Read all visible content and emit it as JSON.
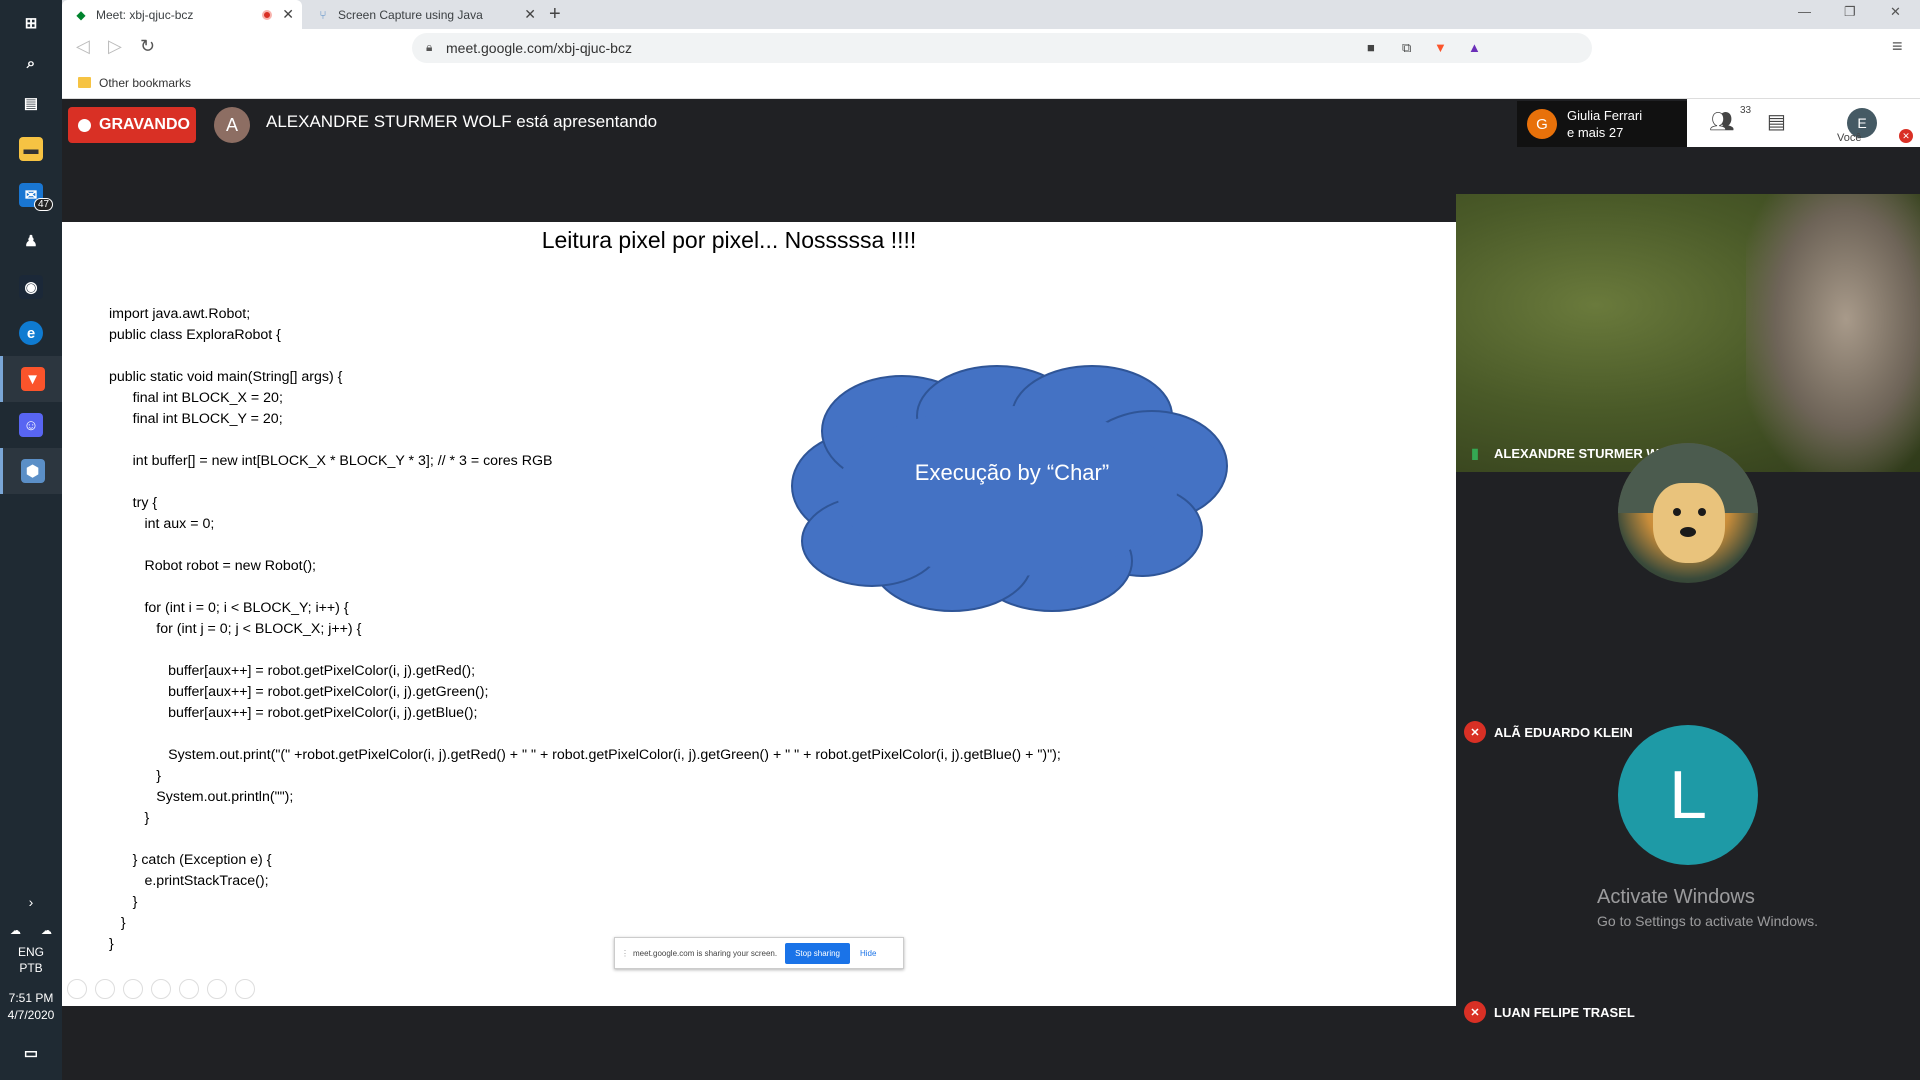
{
  "taskbar": {
    "mail_badge": "47",
    "tray": {
      "lang1": "ENG",
      "lang2": "PTB"
    },
    "clock": {
      "time": "7:51 PM",
      "date": "4/7/2020"
    }
  },
  "browser": {
    "tabs": [
      {
        "title": "Meet: xbj-qjuc-bcz"
      },
      {
        "title": "Screen Capture using Java"
      }
    ],
    "url": "meet.google.com/xbj-qjuc-bcz",
    "bookmarks_folder": "Other bookmarks"
  },
  "meet": {
    "recording_label": "GRAVANDO",
    "presenter_initial": "A",
    "presenter_text": "ALEXANDRE STURMER WOLF está apresentando",
    "participants_chip": {
      "initial": "G",
      "line1": "Giulia Ferrari",
      "line2": "e mais 27"
    },
    "people_count": "33",
    "you_initial": "E",
    "you_label": "Você"
  },
  "slide": {
    "title": "Leitura pixel por pixel... Nosssssa !!!!",
    "code": "import java.awt.Robot;\npublic class ExploraRobot {\n\npublic static void main(String[] args) {\n      final int BLOCK_X = 20;\n      final int BLOCK_Y = 20;\n\n      int buffer[] = new int[BLOCK_X * BLOCK_Y * 3]; // * 3 = cores RGB\n\n      try {\n         int aux = 0;\n\n         Robot robot = new Robot();\n\n         for (int i = 0; i < BLOCK_Y; i++) {\n            for (int j = 0; j < BLOCK_X; j++) {\n\n               buffer[aux++] = robot.getPixelColor(i, j).getRed();\n               buffer[aux++] = robot.getPixelColor(i, j).getGreen();\n               buffer[aux++] = robot.getPixelColor(i, j).getBlue();\n\n               System.out.print(\"(\" +robot.getPixelColor(i, j).getRed() + \" \" + robot.getPixelColor(i, j).getGreen() + \" \" + robot.getPixelColor(i, j).getBlue() + \")\");\n            }\n            System.out.println(\"\");\n         }\n\n      } catch (Exception e) {\n         e.printStackTrace();\n      }\n   }\n}",
    "cloud_text": "Execução by “Char”",
    "share_bar": {
      "message": "meet.google.com is sharing your screen.",
      "stop_label": "Stop sharing",
      "hide_label": "Hide"
    }
  },
  "participants": [
    {
      "name": "ALEXANDRE STURMER WOLF",
      "state": "speaking"
    },
    {
      "name": "ALÃ EDUARDO KLEIN",
      "state": "muted"
    },
    {
      "name": "LUAN FELIPE TRASEL",
      "state": "muted",
      "initial": "L"
    }
  ],
  "watermark": {
    "line1": "Activate Windows",
    "line2": "Go to Settings to activate Windows."
  },
  "colors": {
    "record_red": "#d93025",
    "cloud_blue": "#4472c4",
    "meet_bg": "#202124",
    "avatar_teal": "#1e9aa6"
  }
}
